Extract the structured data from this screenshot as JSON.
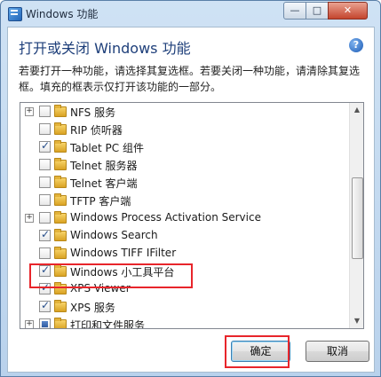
{
  "window": {
    "title": "Windows 功能",
    "icon": "windows-features-icon"
  },
  "title_controls": {
    "minimize": "—",
    "maximize": "□",
    "close": "✕"
  },
  "heading": "打开或关闭 Windows 功能",
  "help_icon": "?",
  "description": "若要打开一种功能，请选择其复选框。若要关闭一种功能，请清除其复选框。填充的框表示仅打开该功能的一部分。",
  "features": [
    {
      "label": "NFS 服务",
      "state": "unchecked",
      "expandable": true
    },
    {
      "label": "RIP 侦听器",
      "state": "unchecked",
      "expandable": false
    },
    {
      "label": "Tablet PC 组件",
      "state": "checked",
      "expandable": false
    },
    {
      "label": "Telnet 服务器",
      "state": "unchecked",
      "expandable": false
    },
    {
      "label": "Telnet 客户端",
      "state": "unchecked",
      "expandable": false
    },
    {
      "label": "TFTP 客户端",
      "state": "unchecked",
      "expandable": false
    },
    {
      "label": "Windows Process Activation Service",
      "state": "unchecked",
      "expandable": true
    },
    {
      "label": "Windows Search",
      "state": "checked",
      "expandable": false
    },
    {
      "label": "Windows TIFF IFilter",
      "state": "unchecked",
      "expandable": false
    },
    {
      "label": "Windows 小工具平台",
      "state": "checked",
      "expandable": false
    },
    {
      "label": "XPS Viewer",
      "state": "checked",
      "expandable": false
    },
    {
      "label": "XPS 服务",
      "state": "checked",
      "expandable": false
    },
    {
      "label": "打印和文件服务",
      "state": "partial",
      "expandable": true
    }
  ],
  "expander_symbol": "+",
  "buttons": {
    "ok": "确定",
    "cancel": "取消"
  },
  "highlight_color": "#e8252b"
}
